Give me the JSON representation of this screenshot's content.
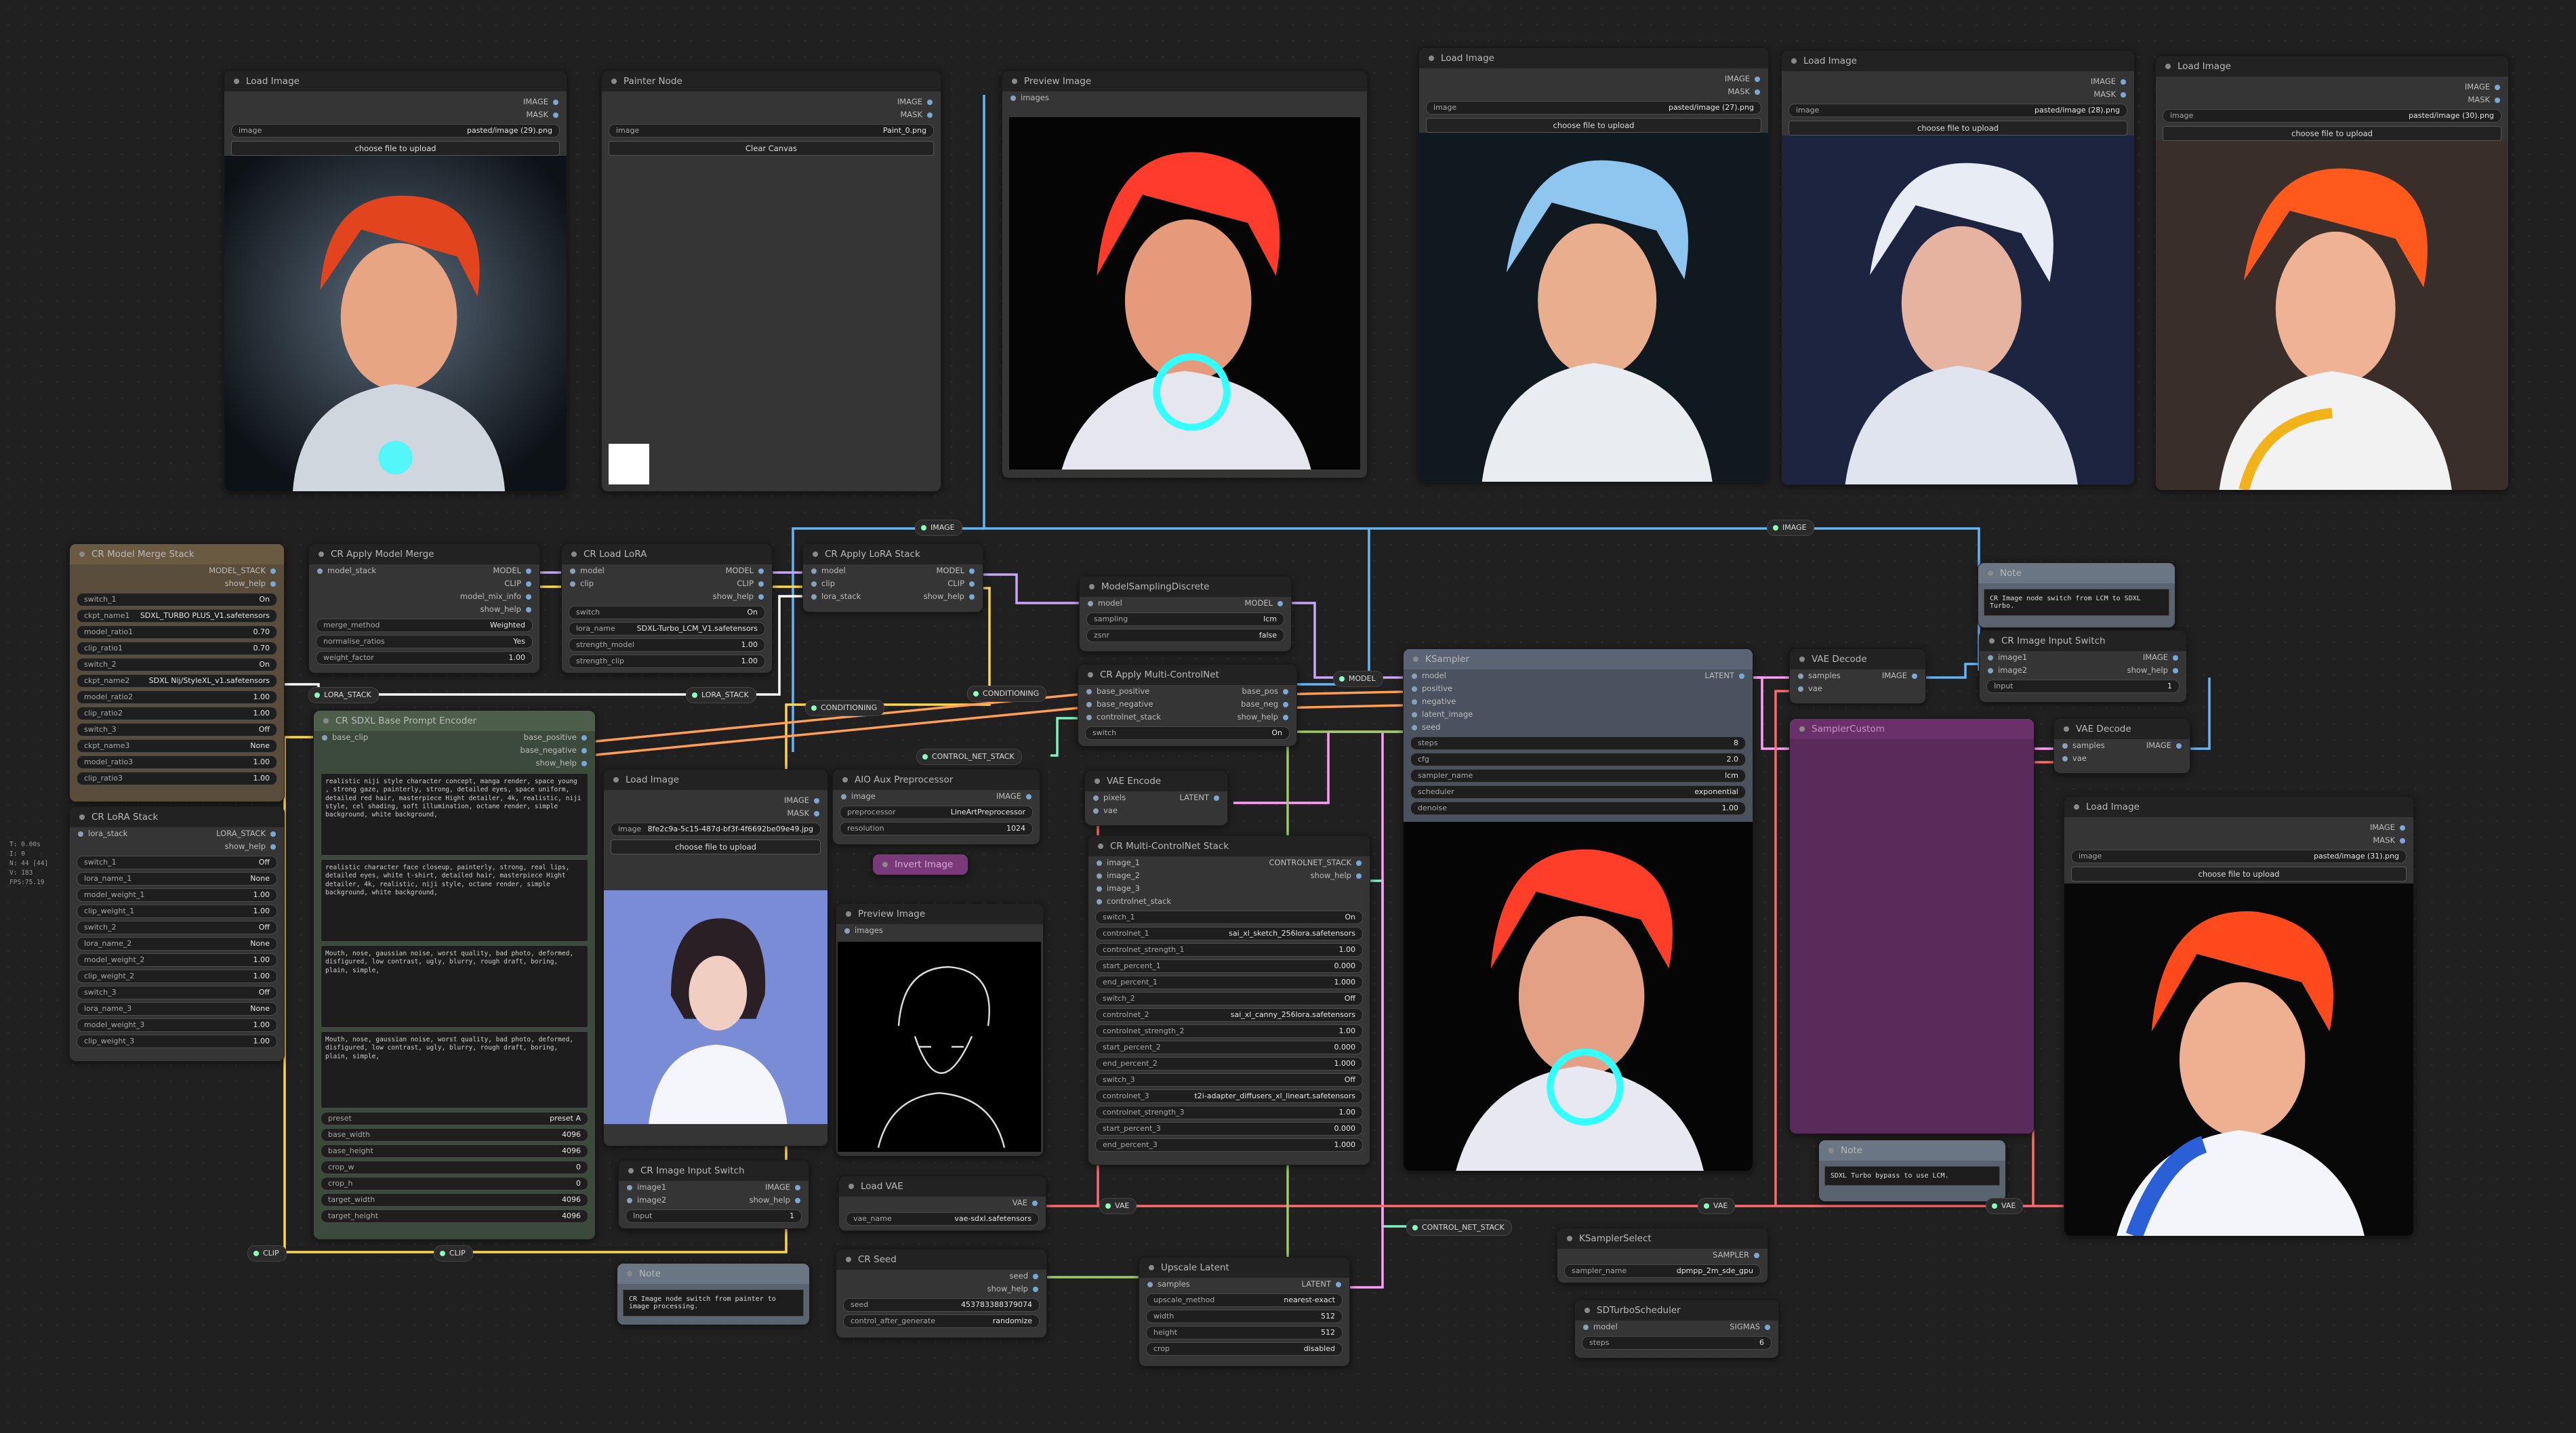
{
  "nodes": {
    "load_image_1": {
      "title": "Load Image",
      "outputs": [
        "IMAGE",
        "MASK"
      ],
      "image_field": "image",
      "image_value": "pasted/image (29).png",
      "upload": "choose file to upload"
    },
    "painter": {
      "title": "Painter Node",
      "outputs": [
        "IMAGE",
        "MASK"
      ],
      "image_field": "image",
      "image_value": "Paint_0.png",
      "clear": "Clear Canvas"
    },
    "preview_1": {
      "title": "Preview Image",
      "input": "images"
    },
    "load_image_2": {
      "title": "Load Image",
      "outputs": [
        "IMAGE",
        "MASK"
      ],
      "image_field": "image",
      "image_value": "pasted/image (27).png",
      "upload": "choose file to upload"
    },
    "load_image_3": {
      "title": "Load Image",
      "outputs": [
        "IMAGE",
        "MASK"
      ],
      "image_field": "image",
      "image_value": "pasted/image (28).png",
      "upload": "choose file to upload"
    },
    "load_image_4": {
      "title": "Load Image",
      "outputs": [
        "IMAGE",
        "MASK"
      ],
      "image_field": "image",
      "image_value": "pasted/image (30).png",
      "upload": "choose file to upload"
    },
    "model_merge": {
      "title": "CR Model Merge Stack",
      "output": "MODEL_STACK",
      "show_help": "show_help",
      "widgets": [
        [
          "switch_1",
          "On"
        ],
        [
          "ckpt_name1",
          "SDXL_TURBO PLUS_V1.safetensors"
        ],
        [
          "model_ratio1",
          "0.70"
        ],
        [
          "clip_ratio1",
          "0.70"
        ],
        [
          "switch_2",
          "On"
        ],
        [
          "ckpt_name2",
          "SDXL Nij/StyleXL_v1.safetensors"
        ],
        [
          "model_ratio2",
          "1.00"
        ],
        [
          "clip_ratio2",
          "1.00"
        ],
        [
          "switch_3",
          "Off"
        ],
        [
          "ckpt_name3",
          "None"
        ],
        [
          "model_ratio3",
          "1.00"
        ],
        [
          "clip_ratio3",
          "1.00"
        ]
      ]
    },
    "apply_merge": {
      "title": "CR Apply Model Merge",
      "input": "model_stack",
      "outputs": [
        "MODEL",
        "CLIP",
        "model_mix_info",
        "show_help"
      ],
      "widgets": [
        [
          "merge_method",
          "Weighted"
        ],
        [
          "normalise_ratios",
          "Yes"
        ],
        [
          "weight_factor",
          "1.00"
        ]
      ]
    },
    "load_lora": {
      "title": "CR Load LoRA",
      "inputs": [
        "model",
        "clip"
      ],
      "outputs": [
        "MODEL",
        "CLIP",
        "show_help"
      ],
      "widgets": [
        [
          "switch",
          "On"
        ],
        [
          "lora_name",
          "SDXL-Turbo_LCM_V1.safetensors"
        ],
        [
          "strength_model",
          "1.00"
        ],
        [
          "strength_clip",
          "1.00"
        ]
      ]
    },
    "apply_lora": {
      "title": "CR Apply LoRA Stack",
      "inputs": [
        "model",
        "clip",
        "lora_stack"
      ],
      "outputs": [
        "MODEL",
        "CLIP",
        "show_help"
      ]
    },
    "model_sampling": {
      "title": "ModelSamplingDiscrete",
      "input": "model",
      "output": "MODEL",
      "widgets": [
        [
          "sampling",
          "lcm"
        ],
        [
          "zsnr",
          "false"
        ]
      ]
    },
    "lora_stack": {
      "title": "CR LoRA Stack",
      "input": "lora_stack",
      "outputs": [
        "LORA_STACK",
        "show_help"
      ],
      "widgets": [
        [
          "switch_1",
          "Off"
        ],
        [
          "lora_name_1",
          "None"
        ],
        [
          "model_weight_1",
          "1.00"
        ],
        [
          "clip_weight_1",
          "1.00"
        ],
        [
          "switch_2",
          "Off"
        ],
        [
          "lora_name_2",
          "None"
        ],
        [
          "model_weight_2",
          "1.00"
        ],
        [
          "clip_weight_2",
          "1.00"
        ],
        [
          "switch_3",
          "Off"
        ],
        [
          "lora_name_3",
          "None"
        ],
        [
          "model_weight_3",
          "1.00"
        ],
        [
          "clip_weight_3",
          "1.00"
        ]
      ]
    },
    "prompt_encoder": {
      "title": "CR SDXL Base Prompt Encoder",
      "input": "base_clip",
      "outputs": [
        "base_positive",
        "base_negative",
        "show_help"
      ],
      "texts": [
        "realistic niji style character concept, manga render, space young , strong gaze, painterly, strong, detailed eyes, space uniform, detailed red hair, masterpiece Hight detailer, 4k, realistic, niji style, cel shading, soft illumination, octane render, simple background, white background,",
        "realistic character face closeup, painterly, strong, real lips, detailed eyes, white t-shirt, detailed hair, masterpiece Hight detailer, 4k, realistic, niji style, octane render, simple background, white background,",
        "Mouth, nose, gaussian noise, worst quality, bad photo, deformed, disfigured, low contrast, ugly, blurry, rough draft, boring, plain, simple,",
        "Mouth, nose, gaussian noise, worst quality, bad photo, deformed, disfigured, low contrast, ugly, blurry, rough draft, boring, plain, simple,"
      ],
      "widgets": [
        [
          "preset",
          "preset A"
        ],
        [
          "base_width",
          "4096"
        ],
        [
          "base_height",
          "4096"
        ],
        [
          "crop_w",
          "0"
        ],
        [
          "crop_h",
          "0"
        ],
        [
          "target_width",
          "4096"
        ],
        [
          "target_height",
          "4096"
        ]
      ]
    },
    "load_image_5": {
      "title": "Load Image",
      "outputs": [
        "IMAGE",
        "MASK"
      ],
      "image_field": "image",
      "image_value": "8fe2c9a-5c15-487d-bf3f-4f6692be09e49.jpg",
      "upload": "choose file to upload"
    },
    "aux_pre": {
      "title": "AIO Aux Preprocessor",
      "input": "image",
      "output": "IMAGE",
      "widgets": [
        [
          "preprocessor",
          "LineArtPreprocessor"
        ],
        [
          "resolution",
          "1024"
        ]
      ]
    },
    "invert": {
      "title": "Invert Image"
    },
    "preview_2": {
      "title": "Preview Image",
      "input": "images"
    },
    "vae_encode": {
      "title": "VAE Encode",
      "inputs": [
        "pixels",
        "vae"
      ],
      "output": "LATENT"
    },
    "multi_cn_apply": {
      "title": "CR Apply Multi-ControlNet",
      "inputs": [
        "base_positive",
        "base_negative",
        "controlnet_stack"
      ],
      "outputs": [
        "base_pos",
        "base_neg",
        "show_help"
      ],
      "widgets": [
        [
          "switch",
          "On"
        ]
      ]
    },
    "multi_cn_stack": {
      "title": "CR Multi-ControlNet Stack",
      "inputs": [
        "image_1",
        "image_2",
        "image_3",
        "controlnet_stack"
      ],
      "outputs": [
        "CONTROLNET_STACK",
        "show_help"
      ],
      "widgets": [
        [
          "switch_1",
          "On"
        ],
        [
          "controlnet_1",
          "sai_xl_sketch_256lora.safetensors"
        ],
        [
          "controlnet_strength_1",
          "1.00"
        ],
        [
          "start_percent_1",
          "0.000"
        ],
        [
          "end_percent_1",
          "1.000"
        ],
        [
          "switch_2",
          "Off"
        ],
        [
          "controlnet_2",
          "sai_xl_canny_256lora.safetensors"
        ],
        [
          "controlnet_strength_2",
          "1.00"
        ],
        [
          "start_percent_2",
          "0.000"
        ],
        [
          "end_percent_2",
          "1.000"
        ],
        [
          "switch_3",
          "Off"
        ],
        [
          "controlnet_3",
          "t2i-adapter_diffusers_xl_lineart.safetensors"
        ],
        [
          "controlnet_strength_3",
          "1.00"
        ],
        [
          "start_percent_3",
          "0.000"
        ],
        [
          "end_percent_3",
          "1.000"
        ]
      ]
    },
    "ksampler": {
      "title": "KSampler",
      "inputs": [
        "model",
        "positive",
        "negative",
        "latent_image",
        "seed"
      ],
      "output": "LATENT",
      "widgets": [
        [
          "steps",
          "8"
        ],
        [
          "cfg",
          "2.0"
        ],
        [
          "sampler_name",
          "lcm"
        ],
        [
          "scheduler",
          "exponential"
        ],
        [
          "denoise",
          "1.00"
        ]
      ]
    },
    "vae_decode_1": {
      "title": "VAE Decode",
      "inputs": [
        "samples",
        "vae"
      ],
      "output": "IMAGE"
    },
    "vae_decode_2": {
      "title": "VAE Decode",
      "inputs": [
        "samples",
        "vae"
      ],
      "output": "IMAGE"
    },
    "custom_sampler": {
      "title": "SamplerCustom"
    },
    "note_1": {
      "title": "Note",
      "text": "CR Image node switch from LCM to SDXL Turbo."
    },
    "note_2": {
      "title": "Note",
      "text": "SDXL Turbo bypass to use LCM."
    },
    "note_3": {
      "title": "Note",
      "text": "CR Image node switch from painter to image processing."
    },
    "img_switch_1": {
      "title": "CR Image Input Switch",
      "inputs": [
        "image1",
        "image2"
      ],
      "outputs": [
        "IMAGE",
        "show_help"
      ],
      "widgets": [
        [
          "Input",
          "1"
        ]
      ]
    },
    "img_switch_2": {
      "title": "CR Image Input Switch",
      "inputs": [
        "image1",
        "image2"
      ],
      "outputs": [
        "IMAGE",
        "show_help"
      ],
      "widgets": [
        [
          "Input",
          "1"
        ]
      ]
    },
    "load_image_6": {
      "title": "Load Image",
      "outputs": [
        "IMAGE",
        "MASK"
      ],
      "image_field": "image",
      "image_value": "pasted/image (31).png",
      "upload": "choose file to upload"
    },
    "load_vae": {
      "title": "Load VAE",
      "output": "VAE",
      "widgets": [
        [
          "vae_name",
          "vae-sdxl.safetensors"
        ]
      ]
    },
    "seed": {
      "title": "CR Seed",
      "outputs": [
        "seed",
        "show_help"
      ],
      "widgets": [
        [
          "seed",
          "453783388379074"
        ],
        [
          "control_after_generate",
          "randomize"
        ]
      ]
    },
    "upscale": {
      "title": "Upscale Latent",
      "input": "samples",
      "output": "LATENT",
      "widgets": [
        [
          "upscale_method",
          "nearest-exact"
        ],
        [
          "width",
          "512"
        ],
        [
          "height",
          "512"
        ],
        [
          "crop",
          "disabled"
        ]
      ]
    },
    "ksampler_select": {
      "title": "KSamplerSelect",
      "output": "SAMPLER",
      "widgets": [
        [
          "sampler_name",
          "dpmpp_2m_sde_gpu"
        ]
      ]
    },
    "sdturbo": {
      "title": "SDTurboScheduler",
      "input": "model",
      "output": "SIGMAS",
      "widgets": [
        [
          "steps",
          "6"
        ]
      ]
    }
  },
  "reroutes": {
    "image": "IMAGE",
    "image2": "IMAGE",
    "lora_stack": "LORA_STACK",
    "lora_stack2": "LORA_STACK",
    "conditioning": "CONDITIONING",
    "conditioning2": "CONDITIONING",
    "control_net_stack": "CONTROL_NET_STACK",
    "control_net_stack2": "CONTROL_NET_STACK",
    "model": "MODEL",
    "clip": "CLIP",
    "clip2": "CLIP",
    "vae": "VAE",
    "vae2": "VAE",
    "vae3": "VAE"
  },
  "stats": [
    "T: 0.00s",
    "I: 0",
    "N: 44 [44]",
    "V: 183",
    "FPS:75.19"
  ]
}
